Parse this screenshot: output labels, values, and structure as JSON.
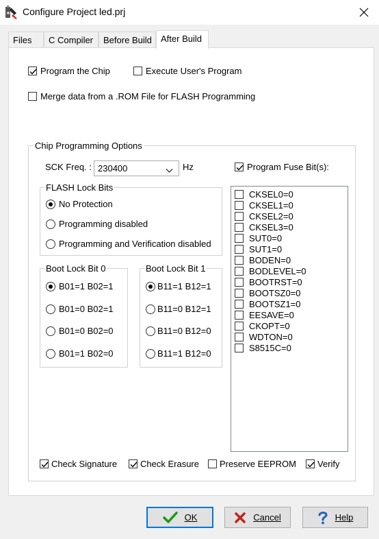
{
  "window": {
    "title": "Configure Project led.prj"
  },
  "tabs": [
    {
      "label": "Files"
    },
    {
      "label": "C Compiler"
    },
    {
      "label": "Before Build"
    },
    {
      "label": "After Build"
    }
  ],
  "active_tab": "After Build",
  "top_options": {
    "program_chip": {
      "label": "Program the Chip",
      "checked": true
    },
    "execute_program": {
      "label": "Execute User's Program",
      "checked": false
    },
    "merge_rom": {
      "label": "Merge data from a .ROM File for FLASH Programming",
      "checked": false
    }
  },
  "chip_options": {
    "title": "Chip Programming Options",
    "sck_label": "SCK Freq. :",
    "sck_value": "230400",
    "sck_unit": "Hz",
    "program_fuse": {
      "label": "Program Fuse Bit(s):",
      "checked": true
    },
    "flash_lock": {
      "title": "FLASH Lock Bits",
      "options": [
        "No Protection",
        "Programming disabled",
        "Programming and Verification disabled"
      ],
      "selected": 0
    },
    "boot_lock_0": {
      "title": "Boot Lock Bit 0",
      "options": [
        "B01=1 B02=1",
        "B01=0 B02=1",
        "B01=0 B02=0",
        "B01=1 B02=0"
      ],
      "selected": 0
    },
    "boot_lock_1": {
      "title": "Boot Lock Bit 1",
      "options": [
        "B11=1 B12=1",
        "B11=0 B12=1",
        "B11=0 B12=0",
        "B11=1 B12=0"
      ],
      "selected": 0
    },
    "fuse_bits": [
      "CKSEL0=0",
      "CKSEL1=0",
      "CKSEL2=0",
      "CKSEL3=0",
      "SUT0=0",
      "SUT1=0",
      "BODEN=0",
      "BODLEVEL=0",
      "BOOTRST=0",
      "BOOTSZ0=0",
      "BOOTSZ1=0",
      "EESAVE=0",
      "CKOPT=0",
      "WDTON=0",
      "S8515C=0"
    ],
    "bottom_checks": {
      "check_signature": {
        "label": "Check Signature",
        "checked": true
      },
      "check_erasure": {
        "label": "Check Erasure",
        "checked": true
      },
      "preserve_eeprom": {
        "label": "Preserve EEPROM",
        "checked": false
      },
      "verify": {
        "label": "Verify",
        "checked": true
      }
    }
  },
  "buttons": {
    "ok": {
      "label": "OK",
      "icon": "check-icon",
      "color": "#1a9a1a"
    },
    "cancel": {
      "label": "Cancel",
      "icon": "x-icon",
      "color": "#c0241a"
    },
    "help": {
      "label": "Help",
      "icon": "question-icon",
      "color": "#1f5fbf"
    }
  }
}
